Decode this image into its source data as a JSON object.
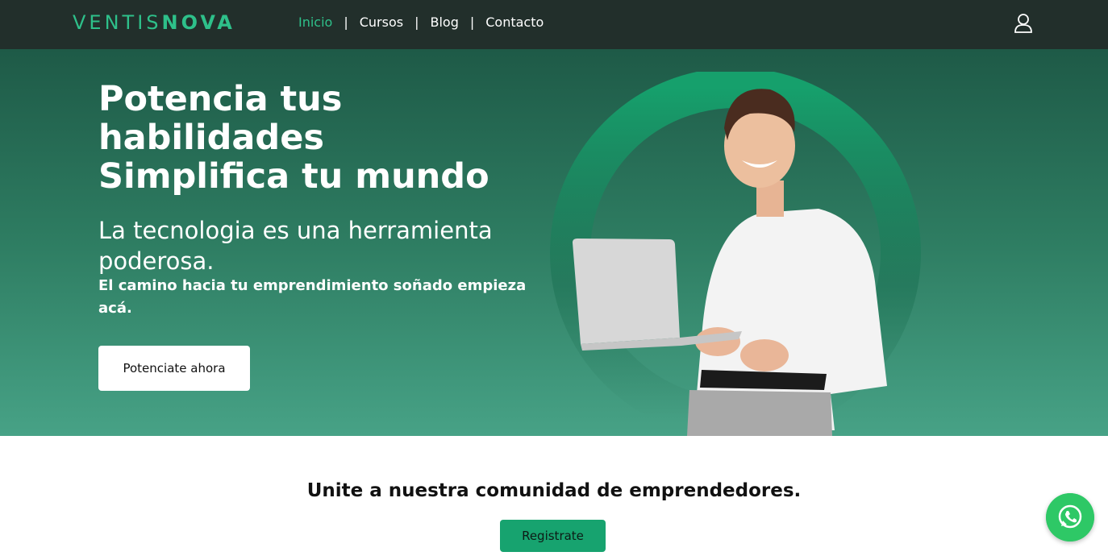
{
  "brand": {
    "logo_light": "VENTIS",
    "logo_bold": "NOVA"
  },
  "nav": {
    "items": [
      "Inicio",
      "Cursos",
      "Blog",
      "Contacto"
    ],
    "separator": "|",
    "active": "Inicio"
  },
  "hero": {
    "headline_1": "Potencia tus",
    "headline_2": "habilidades",
    "headline_3": "Simplifica tu mundo",
    "subheadline": "La tecnologia es una herramienta poderosa.",
    "tagline": "El camino hacia tu emprendimiento soñado empieza acá.",
    "cta_label": "Potenciate ahora"
  },
  "community": {
    "title": "Unite a nuestra comunidad de emprendedores.",
    "button_label": "Registrate"
  },
  "icons": {
    "account": "user-icon",
    "chat": "whatsapp-icon"
  },
  "colors": {
    "accent": "#2ec08a",
    "navbar": "#222f2b",
    "hero_top": "#1e5a47",
    "hero_bottom": "#47a286",
    "register": "#17a36f",
    "whatsapp": "#2ec866"
  }
}
